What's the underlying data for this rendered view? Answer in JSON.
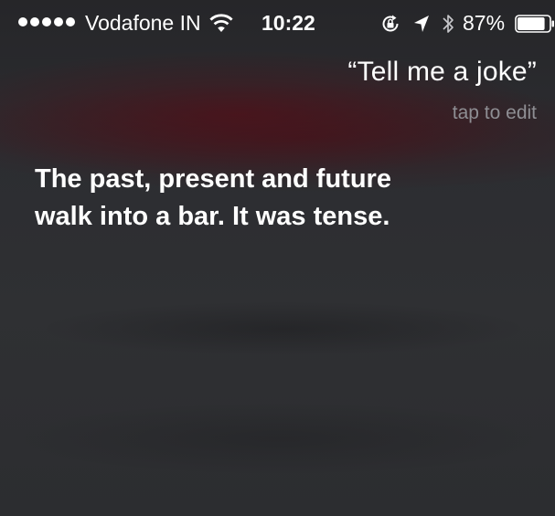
{
  "status_bar": {
    "carrier": "Vodafone IN",
    "time": "10:22",
    "battery_percent": "87%",
    "signal_bars": 5,
    "battery_level": 0.87,
    "icons": [
      "signal-dots",
      "wifi-icon",
      "rotation-lock-icon",
      "location-arrow-icon",
      "bluetooth-icon",
      "battery-icon"
    ]
  },
  "siri": {
    "query": "“Tell me a joke”",
    "tap_to_edit": "tap to edit",
    "response_line1": "The past, present and future",
    "response_line2": "walk into a bar. It was tense."
  },
  "colors": {
    "background": "#2a2b2e",
    "text": "#ffffff",
    "secondary_text": "#8e8e93",
    "glow": "#5a0a14"
  }
}
